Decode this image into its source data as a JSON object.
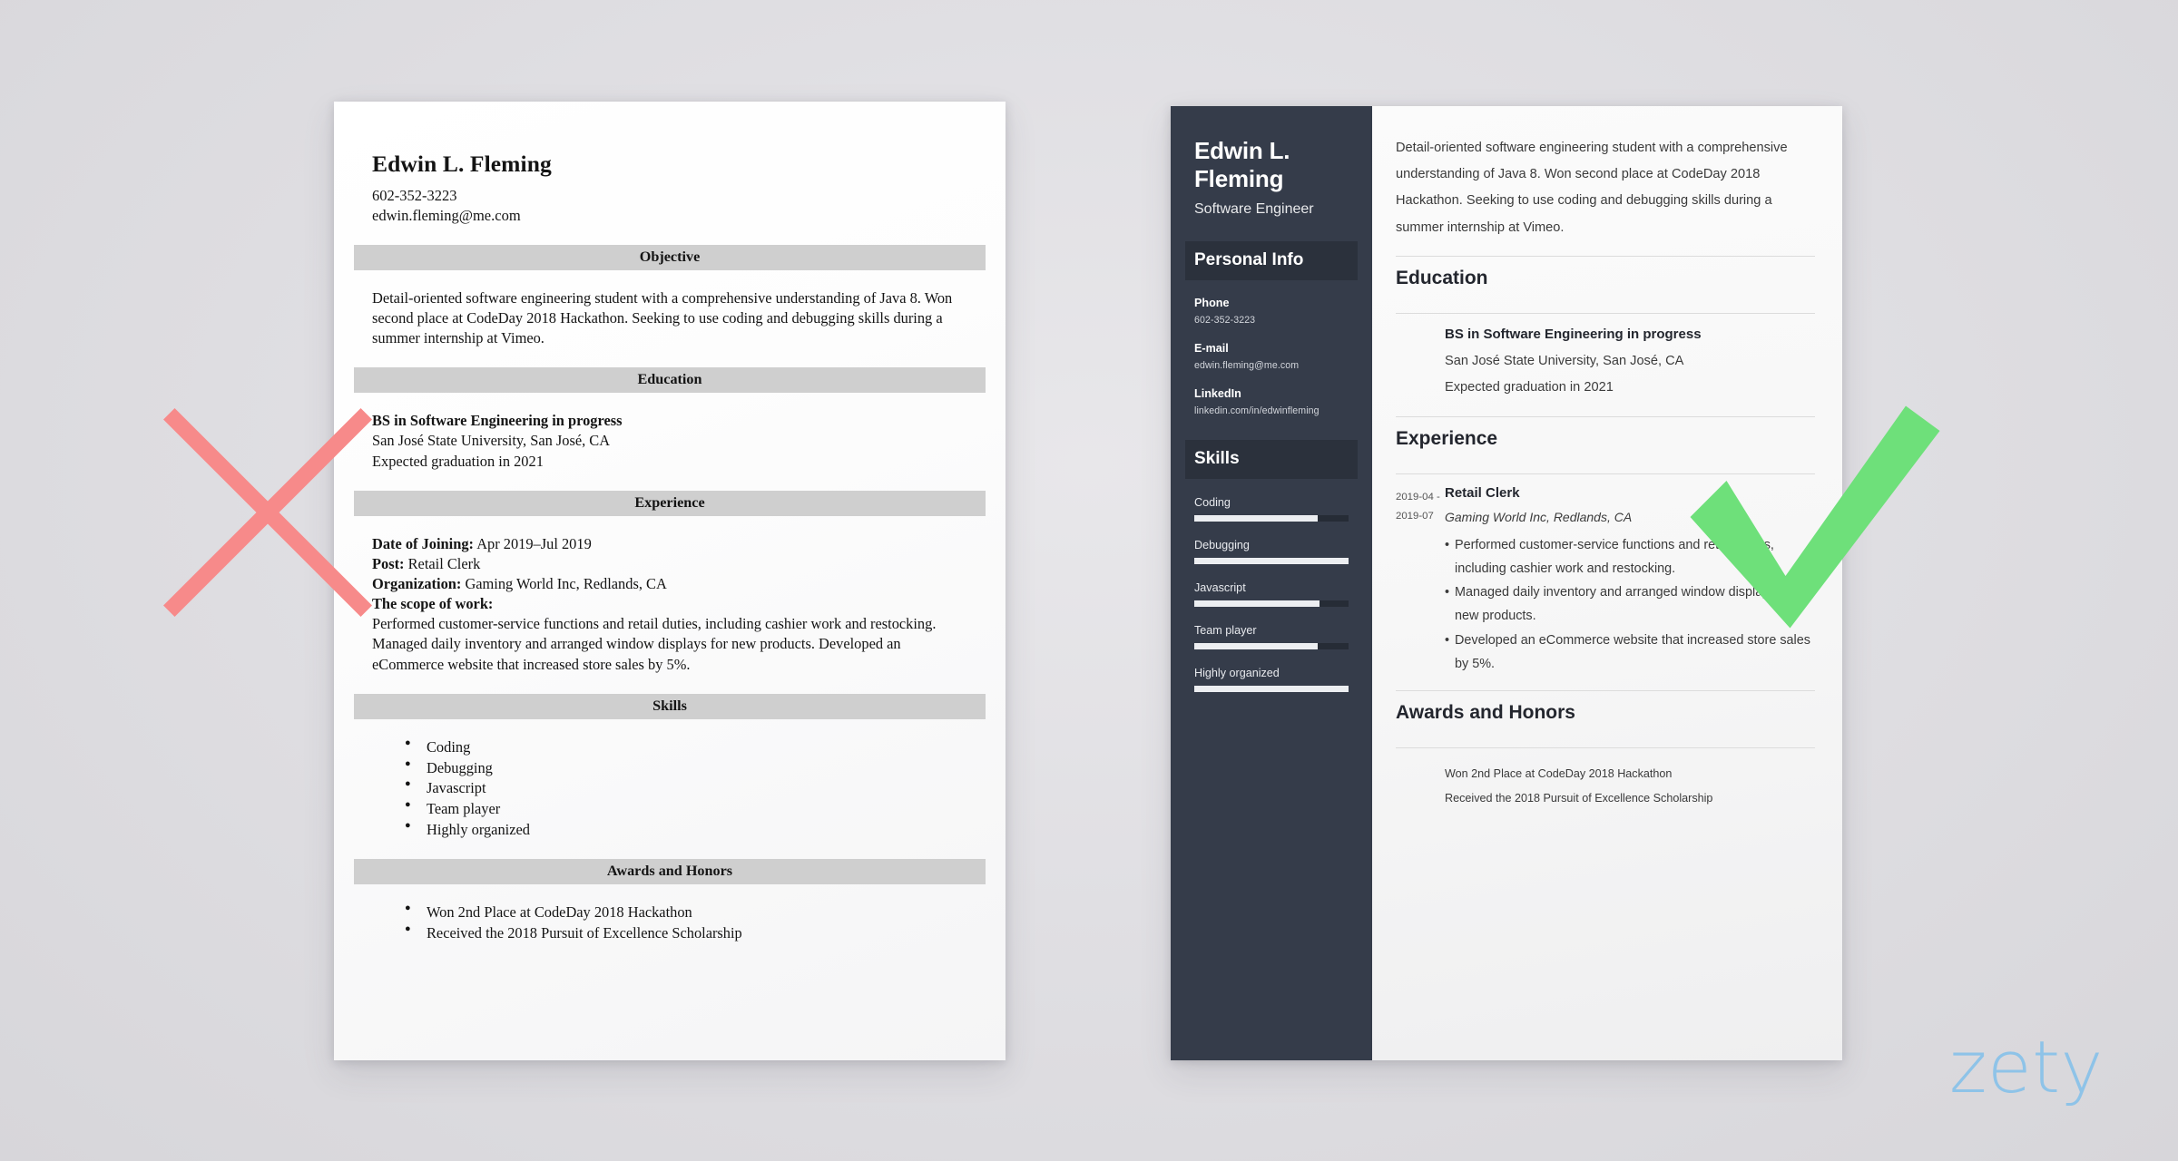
{
  "colors": {
    "page_background": "#dedde0",
    "sidebar_dark": "#353c4a",
    "sidebar_heading_dark": "#2b313c",
    "x_mark_red": "#f78a8a",
    "check_mark_green": "#6ee07a",
    "logo_blue": "#8ec3e8",
    "bad_section_bar_gray": "#cfcfcf"
  },
  "bad_resume": {
    "name": "Edwin L. Fleming",
    "phone": "602-352-3223",
    "email": "edwin.fleming@me.com",
    "sections": {
      "objective_heading": "Objective",
      "objective_text": "Detail-oriented software engineering student with a comprehensive understanding of Java 8. Won second place at CodeDay 2018 Hackathon. Seeking to use coding and debugging skills during a summer internship at Vimeo.",
      "education_heading": "Education",
      "education_degree": "BS in Software Engineering in progress",
      "education_school": "San José State University, San José, CA",
      "education_graduation": "Expected graduation in 2021",
      "experience_heading": "Experience",
      "experience_date_label": "Date of Joining:",
      "experience_date_value": " Apr 2019–Jul 2019",
      "experience_post_label": "Post:",
      "experience_post_value": " Retail Clerk",
      "experience_org_label": "Organization:",
      "experience_org_value": " Gaming World Inc, Redlands, CA",
      "experience_scope_label": "The scope of work:",
      "experience_scope_text": "Performed customer-service functions and retail duties, including cashier work and restocking. Managed daily inventory and arranged window displays for new products. Developed an eCommerce website that increased store sales by 5%.",
      "skills_heading": "Skills",
      "skills": [
        "Coding",
        "Debugging",
        "Javascript",
        "Team player",
        "Highly organized"
      ],
      "awards_heading": "Awards and Honors",
      "awards": [
        "Won 2nd Place at CodeDay 2018 Hackathon",
        "Received the 2018 Pursuit of Excellence Scholarship"
      ]
    }
  },
  "good_resume": {
    "sidebar": {
      "name": "Edwin L. Fleming",
      "job_title": "Software Engineer",
      "personal_info_heading": "Personal Info",
      "fields": [
        {
          "label": "Phone",
          "value": "602-352-3223"
        },
        {
          "label": "E-mail",
          "value": "edwin.fleming@me.com"
        },
        {
          "label": "LinkedIn",
          "value": "linkedin.com/in/edwinfleming"
        }
      ],
      "skills_heading": "Skills",
      "skills": [
        {
          "name": "Coding",
          "level": 80
        },
        {
          "name": "Debugging",
          "level": 100
        },
        {
          "name": "Javascript",
          "level": 81
        },
        {
          "name": "Team player",
          "level": 80
        },
        {
          "name": "Highly organized",
          "level": 100
        }
      ]
    },
    "main": {
      "summary": "Detail-oriented software engineering student with a comprehensive understanding of Java 8. Won second place at CodeDay 2018 Hackathon. Seeking to use coding and debugging skills during a summer internship at Vimeo.",
      "education_heading": "Education",
      "education": {
        "degree": "BS in Software Engineering in progress",
        "school": "San José State University, San José, CA",
        "graduation": "Expected graduation in 2021"
      },
      "experience_heading": "Experience",
      "experience": {
        "date_start": "2019-04 -",
        "date_end": "2019-07",
        "role": "Retail Clerk",
        "company": "Gaming World Inc, Redlands, CA",
        "bullets": [
          "Performed customer-service functions and retail duties, including cashier work and restocking.",
          "Managed daily inventory and arranged window displays for new products.",
          "Developed an eCommerce website that increased store sales by 5%."
        ]
      },
      "awards_heading": "Awards and Honors",
      "awards": [
        "Won 2nd Place at CodeDay 2018 Hackathon",
        "Received the 2018 Pursuit of Excellence Scholarship"
      ]
    }
  },
  "marks": {
    "x_mark_name": "x-mark-icon",
    "check_mark_name": "check-mark-icon"
  },
  "branding": {
    "logo_text": "zety"
  }
}
